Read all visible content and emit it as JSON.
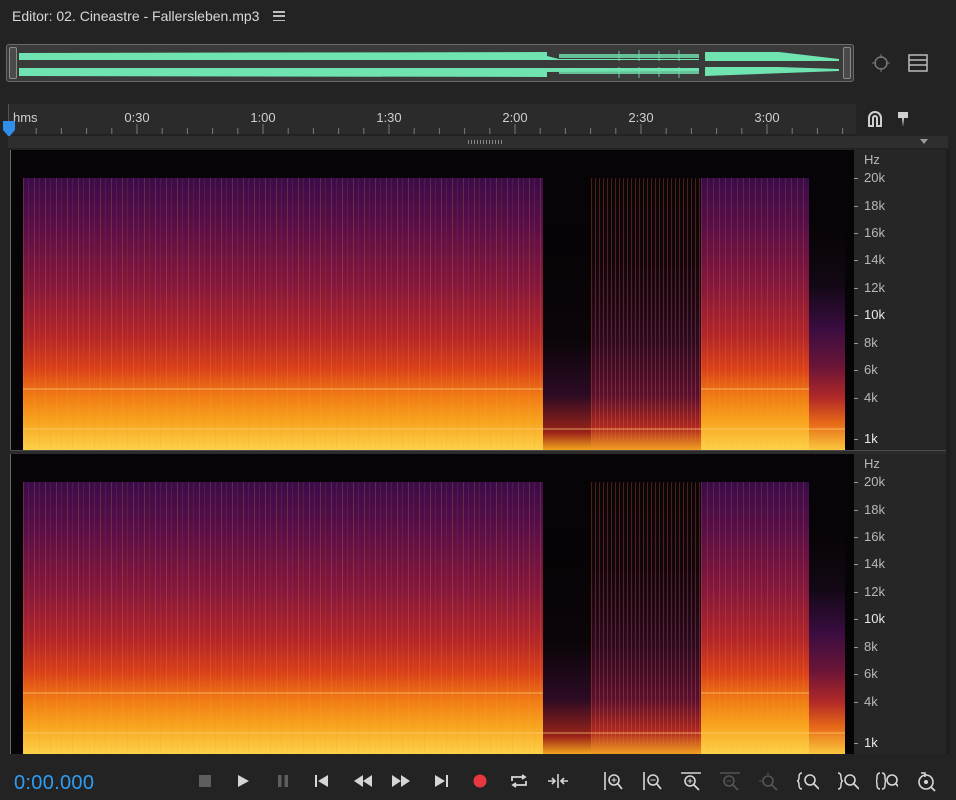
{
  "window": {
    "title": "Editor: 02. Cineastre - Fallersleben.mp3"
  },
  "ruler": {
    "unit": "hms",
    "ticks": [
      "0:30",
      "1:00",
      "1:30",
      "2:00",
      "2:30",
      "3:00"
    ]
  },
  "channels": [
    {
      "hz_unit": "Hz",
      "labels": [
        "20k",
        "18k",
        "16k",
        "14k",
        "12k",
        "10k",
        "8k",
        "6k",
        "4k",
        "1k"
      ]
    },
    {
      "hz_unit": "Hz",
      "labels": [
        "20k",
        "18k",
        "16k",
        "14k",
        "12k",
        "10k",
        "8k",
        "6k",
        "4k",
        "1k"
      ]
    }
  ],
  "transport": {
    "timecode": "0:00.000",
    "record_color": "#e8383d",
    "timecode_color": "#2f9df4"
  },
  "colors": {
    "waveform": "#6fe3b0",
    "accent": "#2f9df4"
  },
  "icons": {
    "overview_zoom": "zoom-target-icon",
    "overview_list": "list-view-icon",
    "ruler_snap": "magnet-icon",
    "ruler_marker": "marker-pin-icon",
    "transport": [
      "stop-icon",
      "play-icon",
      "pause-icon",
      "skip-to-start-icon",
      "rewind-icon",
      "fast-forward-icon",
      "skip-to-end-icon",
      "record-icon",
      "loop-icon",
      "skip-selection-icon",
      "zoom-in-amplitude-icon",
      "zoom-out-amplitude-icon",
      "zoom-in-time-icon",
      "zoom-out-time-icon",
      "zoom-out-full-icon",
      "zoom-in-selection-left-icon",
      "zoom-in-selection-right-icon",
      "zoom-to-selection-icon",
      "reset-zoom-icon"
    ]
  }
}
